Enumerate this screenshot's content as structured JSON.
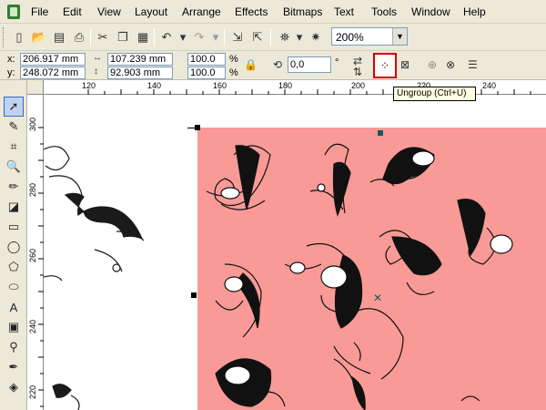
{
  "menu": {
    "items": [
      "File",
      "Edit",
      "View",
      "Layout",
      "Arrange",
      "Effects",
      "Bitmaps",
      "Text",
      "Tools",
      "Window",
      "Help"
    ]
  },
  "toolbar": {
    "zoom": "200%"
  },
  "property_bar": {
    "x_label": "x:",
    "x_value": "206.917 mm",
    "y_label": "y:",
    "y_value": "248.072 mm",
    "width_value": "107.239 mm",
    "height_value": "92.903 mm",
    "scale_x": "100.0",
    "scale_y": "100.0",
    "percent_1": "%",
    "percent_2": "%",
    "rotation": "0,0",
    "degree": "°"
  },
  "tooltip": {
    "text": "Ungroup (Ctrl+U)"
  },
  "rulers": {
    "horizontal": [
      "120",
      "140",
      "160",
      "180",
      "200",
      "220",
      "240"
    ],
    "vertical": [
      "300",
      "280",
      "260",
      "240",
      "220"
    ]
  },
  "colors": {
    "page_background": "#f99a96",
    "highlight_border": "#d00000",
    "tooltip_background": "#ffffe1"
  }
}
